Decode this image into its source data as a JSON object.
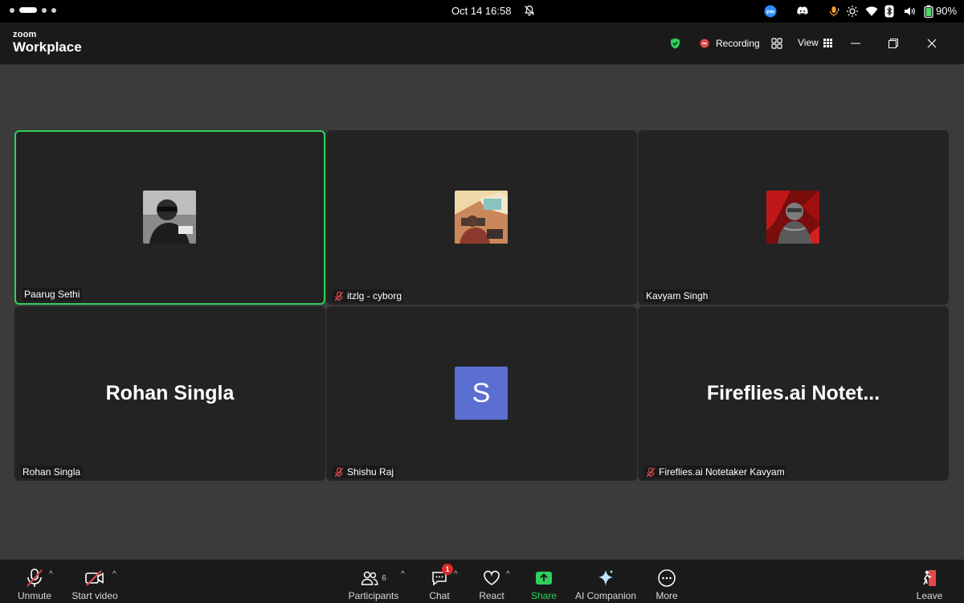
{
  "os": {
    "clock": "Oct 14  16:58",
    "battery": "90%"
  },
  "app": {
    "brand_small": "zoom",
    "brand_big": "Workplace",
    "recording_label": "Recording",
    "view_label": "View"
  },
  "tiles": [
    {
      "name": "Paarug Sethi",
      "muted": false,
      "active": true
    },
    {
      "name": "itzlg - cyborg",
      "muted": true,
      "active": false
    },
    {
      "name": "Kavyam Singh",
      "muted": false,
      "active": false
    },
    {
      "name": "Rohan Singla",
      "display": "Rohan Singla",
      "muted": false,
      "active": false
    },
    {
      "name": "Shishu Raj",
      "avatar_letter": "S",
      "muted": true,
      "active": false
    },
    {
      "name": "Fireflies.ai Notetaker Kavyam",
      "display": "Fireflies.ai Notet...",
      "muted": true,
      "active": false
    }
  ],
  "toolbar": {
    "unmute": "Unmute",
    "start_video": "Start video",
    "participants": "Participants",
    "participants_count": "6",
    "chat": "Chat",
    "chat_badge": "1",
    "react": "React",
    "share": "Share",
    "ai_companion": "AI Companion",
    "more": "More",
    "leave": "Leave"
  },
  "colors": {
    "active_border": "#2ed15c",
    "share_green": "#2ed15c",
    "record_red": "#e24a4a",
    "badge_red": "#e02828",
    "avatar_blue": "#5b6fd1"
  }
}
